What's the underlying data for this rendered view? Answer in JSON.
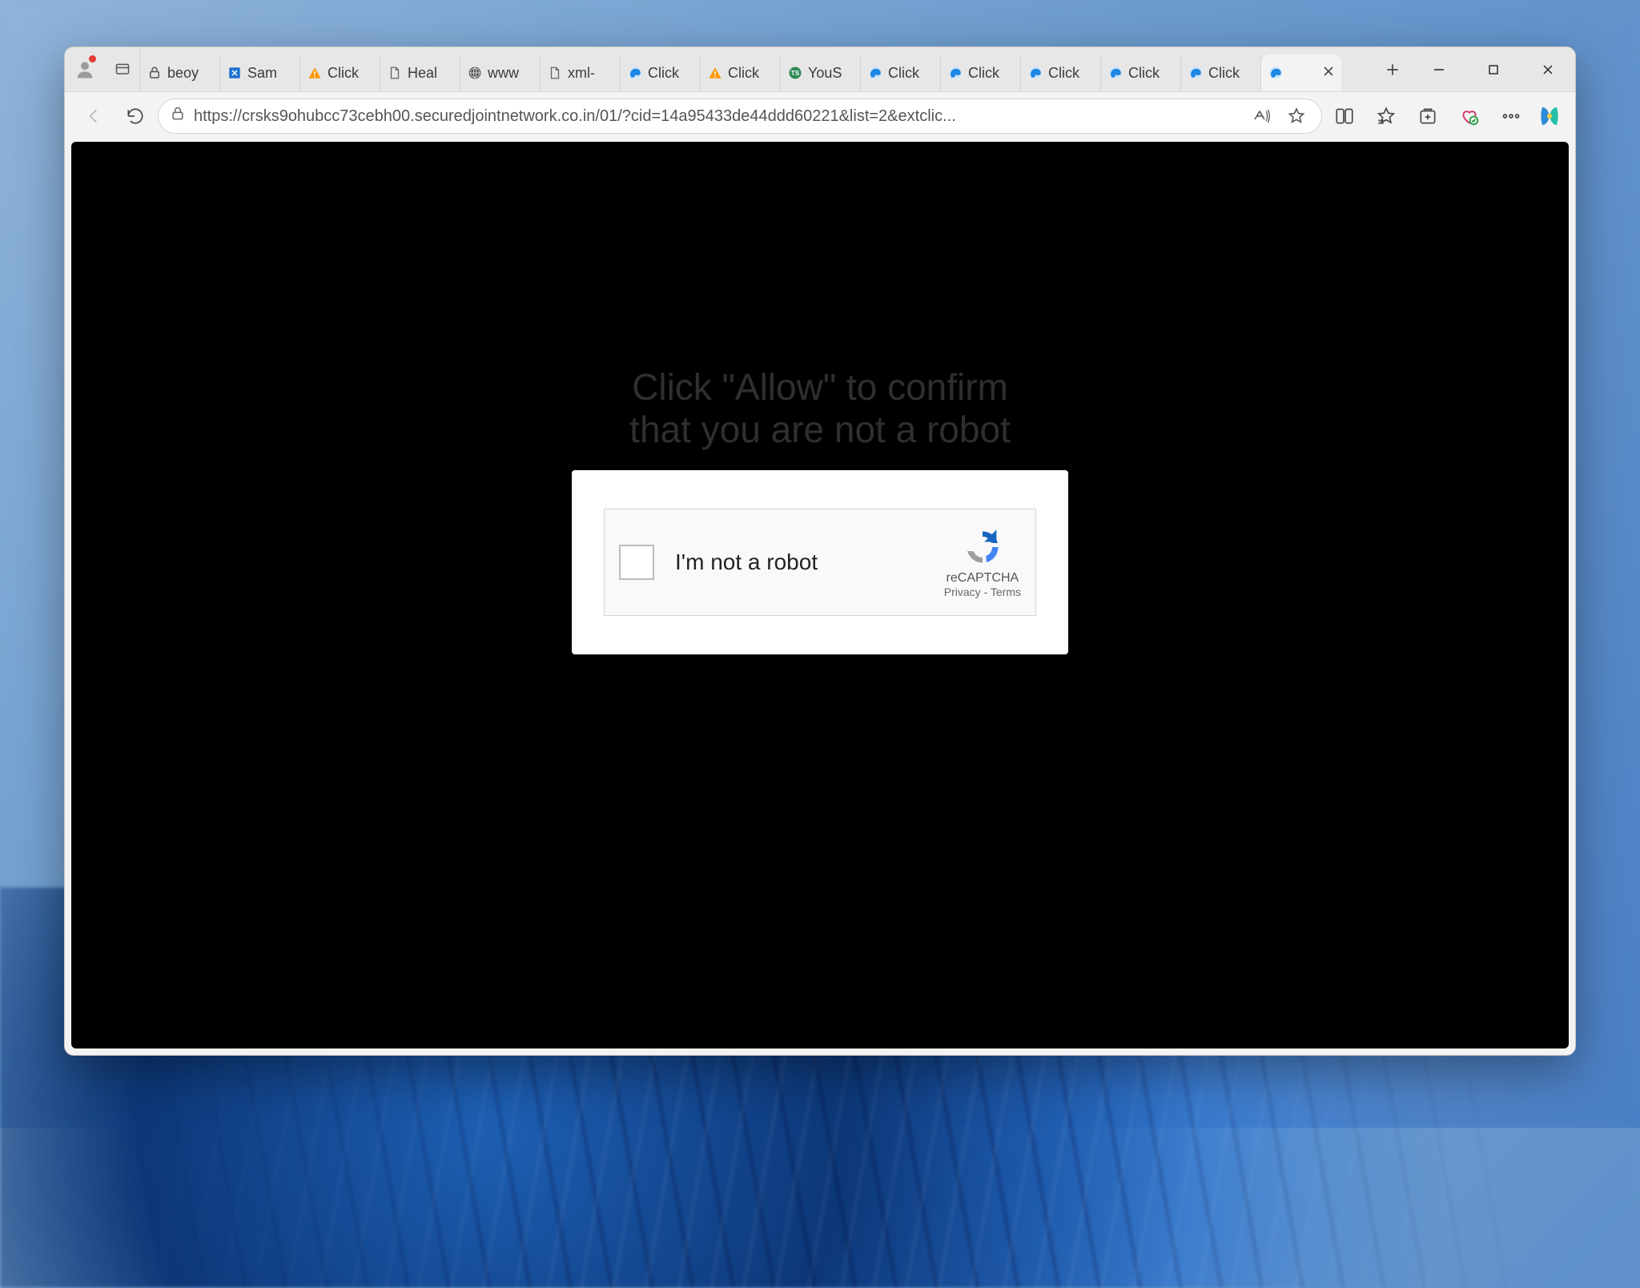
{
  "url": "https://crsks9ohubcc73cebh00.securedjointnetwork.co.in/01/?cid=14a95433de44ddd60221&list=2&extclic...",
  "tabs": [
    {
      "label": "beoy",
      "icon": "lock"
    },
    {
      "label": "Sam",
      "icon": "box"
    },
    {
      "label": "Click",
      "icon": "warn"
    },
    {
      "label": "Heal",
      "icon": "page"
    },
    {
      "label": "www",
      "icon": "globe"
    },
    {
      "label": "xml-",
      "icon": "page"
    },
    {
      "label": "Click",
      "icon": "edge"
    },
    {
      "label": "Click",
      "icon": "warn"
    },
    {
      "label": "YouS",
      "icon": "ts"
    },
    {
      "label": "Click",
      "icon": "edge"
    },
    {
      "label": "Click",
      "icon": "edge"
    },
    {
      "label": "Click",
      "icon": "edge"
    },
    {
      "label": "Click",
      "icon": "edge"
    },
    {
      "label": "Click",
      "icon": "edge"
    },
    {
      "label": "",
      "icon": "edge",
      "active": true
    }
  ],
  "page": {
    "prompt_line1": "Click \"Allow\" to confirm",
    "prompt_line2": "that you are not a robot",
    "captcha_text": "I'm not a robot",
    "captcha_brand": "reCAPTCHA",
    "captcha_privacy": "Privacy",
    "captcha_terms": "Terms"
  }
}
